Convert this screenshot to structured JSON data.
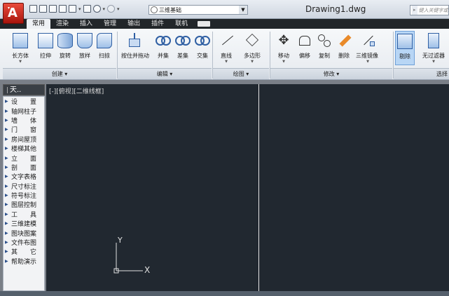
{
  "title": {
    "document": "Drawing1.dwg",
    "workspace": "三维基础",
    "search_placeholder": "键入关键字或短语"
  },
  "tabs": [
    "常用",
    "渲染",
    "插入",
    "管理",
    "输出",
    "插件",
    "联机"
  ],
  "active_tab": "常用",
  "ribbon": {
    "groups": [
      {
        "label": "创建 ▾",
        "buttons": [
          "长方体",
          "拉伸",
          "旋转",
          "放样",
          "扫掠"
        ]
      },
      {
        "label": "编辑 ▾",
        "buttons": [
          "按住并拖动",
          "并集",
          "差集",
          "交集"
        ]
      },
      {
        "label": "绘图 ▾",
        "buttons": [
          "直线",
          "多边形"
        ]
      },
      {
        "label": "修改 ▾",
        "buttons": [
          "移动",
          "偏移",
          "复制",
          "删除",
          "三维镜像"
        ]
      },
      {
        "label": "选择",
        "buttons": [
          "剔除",
          "无过滤器"
        ]
      }
    ]
  },
  "sidebar": {
    "header": "天..",
    "items": [
      "设　　置",
      "轴网柱子",
      "墙　　体",
      "门　　窗",
      "房间屋顶",
      "楼梯其他",
      "立　　面",
      "剖　　面",
      "文字表格",
      "尺寸标注",
      "符号标注",
      "图层控制",
      "工　　具",
      "三维建模",
      "图块图案",
      "文件布图",
      "其　　它",
      "帮助演示"
    ]
  },
  "viewport": {
    "label": "[-][俯视][二维线框]",
    "ucs_x": "X",
    "ucs_y": "Y"
  },
  "colors": {
    "canvas": "#212830",
    "logo": "#d2261b",
    "active_tab": "#eef1f5"
  }
}
